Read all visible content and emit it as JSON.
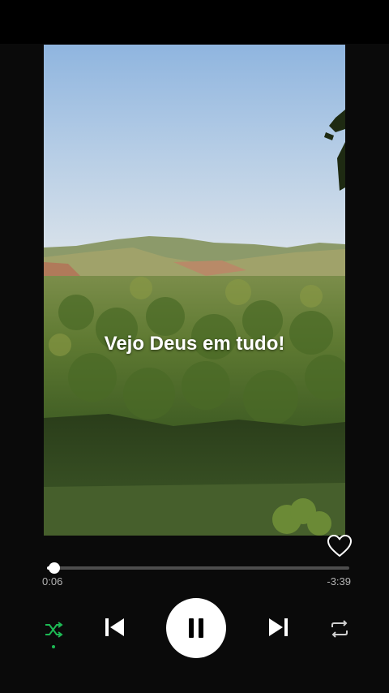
{
  "player": {
    "overlay_text": "Vejo Deus em tudo!",
    "elapsed_time": "0:06",
    "remaining_time": "-3:39",
    "progress_fraction": 0.025,
    "liked": false,
    "shuffle_active": true,
    "is_playing": true
  },
  "colors": {
    "accent": "#1db954",
    "track": "#4d4d4d",
    "text_secondary": "#b3b3b3"
  },
  "icons": {
    "like": "heart-icon",
    "shuffle": "shuffle-icon",
    "previous": "skip-previous-icon",
    "play_pause": "pause-icon",
    "next": "skip-next-icon",
    "repeat": "repeat-icon"
  }
}
